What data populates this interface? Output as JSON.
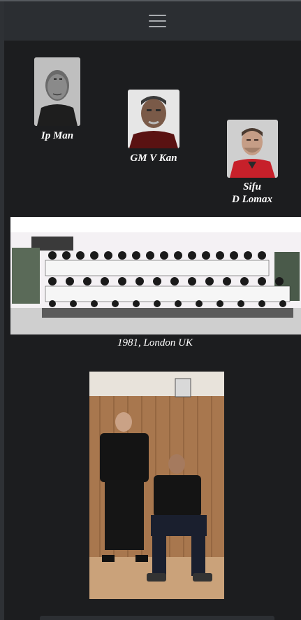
{
  "nav": {
    "menu_icon": "hamburger-menu-icon"
  },
  "portraits": [
    {
      "caption_line1": "Ip Man"
    },
    {
      "caption_line1": "GM V Kan"
    },
    {
      "caption_line1": "Sifu",
      "caption_line2": "D Lomax"
    }
  ],
  "group_photo": {
    "caption": "1981, London UK"
  },
  "colors": {
    "background": "#1c1d1f",
    "navbar": "#2b2e32",
    "text": "#ffffff"
  }
}
